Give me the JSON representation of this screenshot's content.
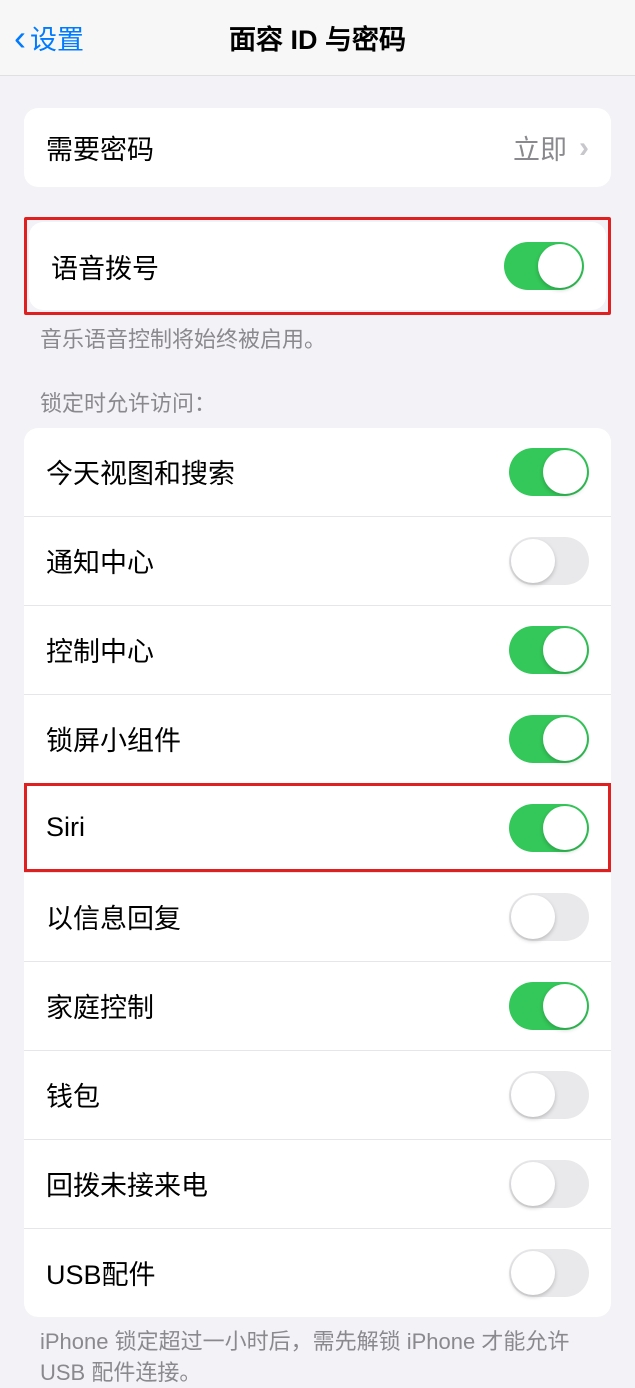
{
  "header": {
    "back_label": "设置",
    "title": "面容 ID 与密码"
  },
  "require_passcode": {
    "label": "需要密码",
    "value": "立即"
  },
  "voice_dial": {
    "label": "语音拨号",
    "footer": "音乐语音控制将始终被启用。"
  },
  "lock_section": {
    "header": "锁定时允许访问：",
    "items": [
      {
        "label": "今天视图和搜索",
        "on": true,
        "key": "today"
      },
      {
        "label": "通知中心",
        "on": false,
        "key": "notification-center"
      },
      {
        "label": "控制中心",
        "on": true,
        "key": "control-center"
      },
      {
        "label": "锁屏小组件",
        "on": true,
        "key": "lockscreen-widgets"
      },
      {
        "label": "Siri",
        "on": true,
        "key": "siri",
        "highlighted": true
      },
      {
        "label": "以信息回复",
        "on": false,
        "key": "reply-with-message"
      },
      {
        "label": "家庭控制",
        "on": true,
        "key": "home-control"
      },
      {
        "label": "钱包",
        "on": false,
        "key": "wallet"
      },
      {
        "label": "回拨未接来电",
        "on": false,
        "key": "return-missed-calls"
      },
      {
        "label": "USB配件",
        "on": false,
        "key": "usb-accessories"
      }
    ],
    "footer": "iPhone 锁定超过一小时后，需先解锁 iPhone 才能允许 USB 配件连接。"
  }
}
